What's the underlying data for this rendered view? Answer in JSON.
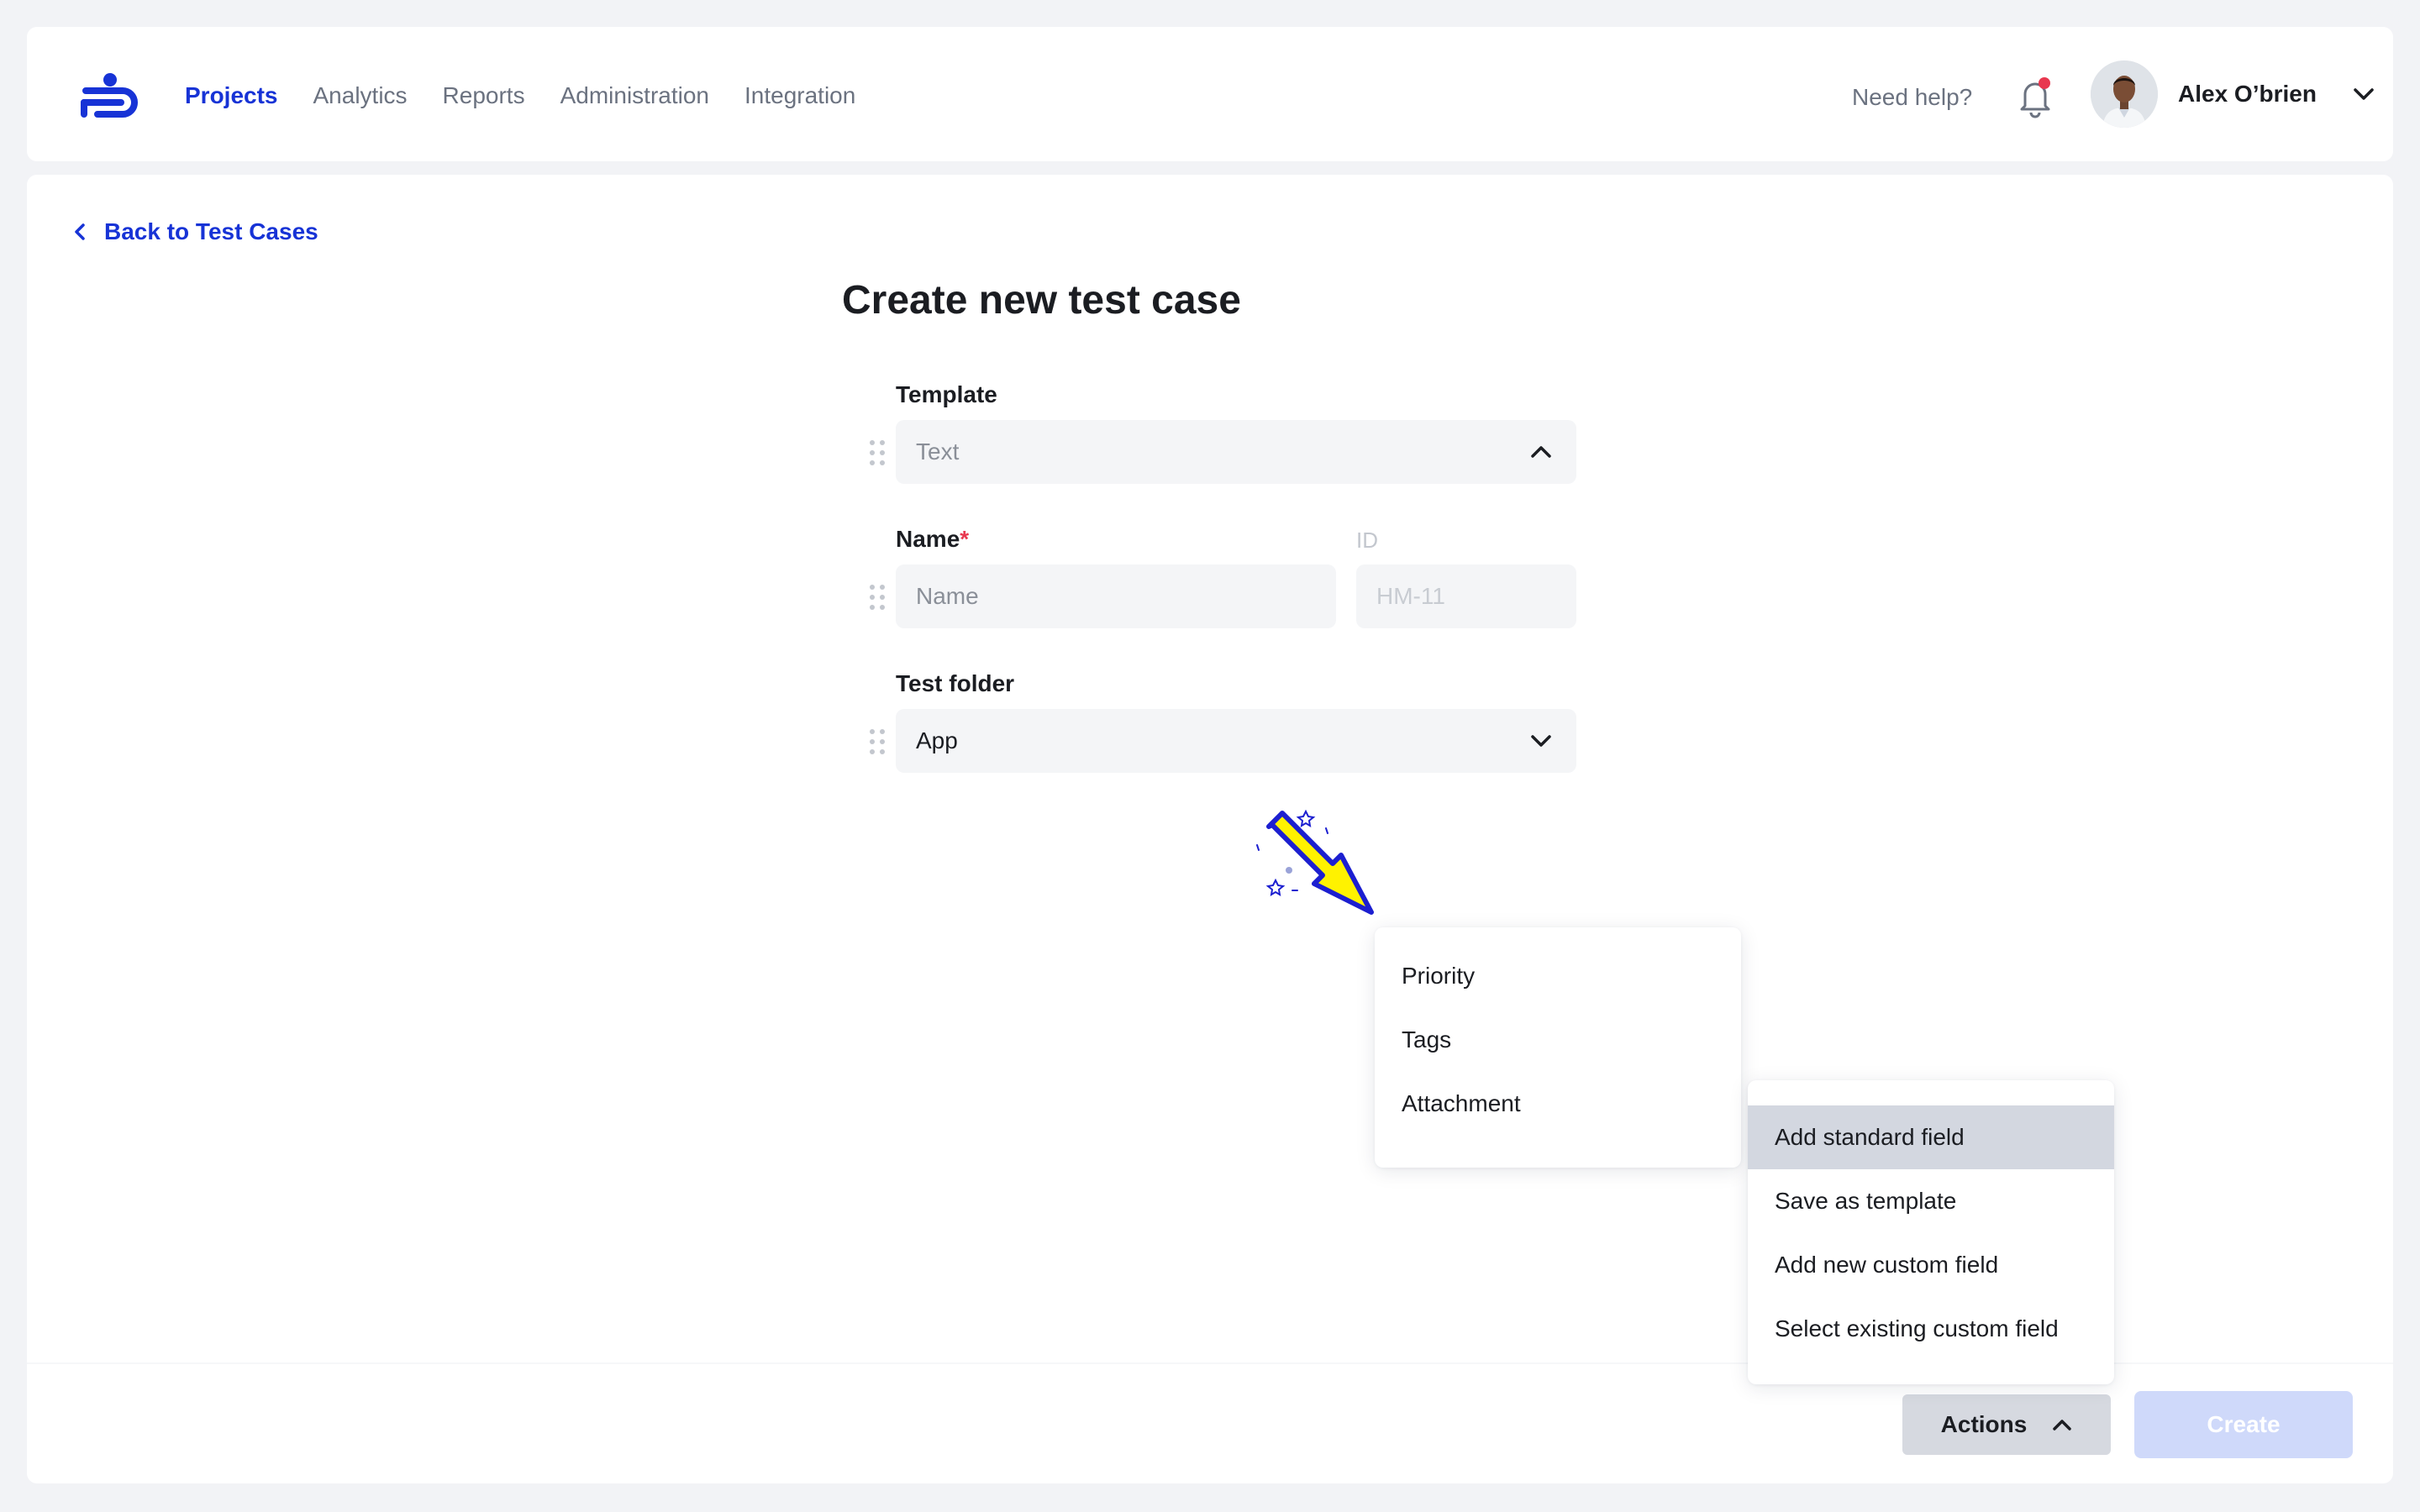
{
  "nav": {
    "items": [
      {
        "label": "Projects",
        "active": true
      },
      {
        "label": "Analytics",
        "active": false
      },
      {
        "label": "Reports",
        "active": false
      },
      {
        "label": "Administration",
        "active": false
      },
      {
        "label": "Integration",
        "active": false
      }
    ],
    "help": "Need help?",
    "user_name": "Alex O’brien",
    "notification_dot": true
  },
  "back_link": "Back to Test Cases",
  "page_title": "Create new test case",
  "form": {
    "template": {
      "label": "Template",
      "value": "Text"
    },
    "name": {
      "label": "Name",
      "required_mark": "*",
      "placeholder": "Name"
    },
    "id": {
      "label": "ID",
      "placeholder": "HM-11"
    },
    "folder": {
      "label": "Test folder",
      "value": "App"
    }
  },
  "standard_field_menu": [
    "Priority",
    "Tags",
    "Attachment"
  ],
  "actions_menu": {
    "items": [
      "Add standard field",
      "Save as template",
      "Add new custom field",
      "Select existing custom field"
    ],
    "highlighted": "Add standard field"
  },
  "footer": {
    "actions_label": "Actions",
    "create_label": "Create"
  },
  "colors": {
    "accent": "#1733d6",
    "required": "#e8384f",
    "arrow": "#fff200"
  }
}
